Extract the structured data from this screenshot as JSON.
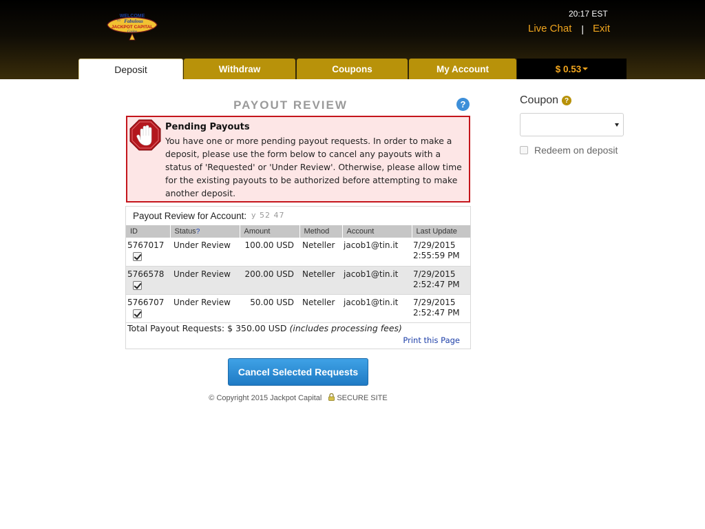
{
  "header": {
    "logo_text": [
      "WELCOME",
      "TO",
      "Fabulous",
      "JACKPOT CAPITAL",
      "Casino"
    ],
    "clock": "20:17 EST",
    "live_chat_label": "Live Chat",
    "separator": "|",
    "exit_label": "Exit"
  },
  "tabs": {
    "deposit": "Deposit",
    "withdraw": "Withdraw",
    "coupons": "Coupons",
    "my_account": "My Account",
    "balance": "$ 0.53"
  },
  "main": {
    "title": "PAYOUT REVIEW",
    "help_icon": "?",
    "alert": {
      "title": "Pending Payouts",
      "text": "You have one or more pending payout requests. In order to make a deposit, please use the form below to cancel any payouts with a status of 'Requested' or 'Under Review'. Otherwise, please allow time for the existing payouts to be authorized before attempting to make another deposit."
    },
    "review": {
      "account_label": "Payout Review for Account:",
      "account_value": "y  52  47",
      "columns": {
        "id": "ID",
        "status": "Status",
        "status_help": "?",
        "amount": "Amount",
        "method": "Method",
        "account": "Account",
        "last_update": "Last Update"
      },
      "rows": [
        {
          "id": "5767017",
          "status": "Under Review",
          "amount": "100.00 USD",
          "method": "Neteller",
          "account": "jacob1@tin.it",
          "date": "7/29/2015",
          "time": "2:55:59 PM",
          "checked": true
        },
        {
          "id": "5766578",
          "status": "Under Review",
          "amount": "200.00 USD",
          "method": "Neteller",
          "account": "jacob1@tin.it",
          "date": "7/29/2015",
          "time": "2:52:47 PM",
          "checked": true
        },
        {
          "id": "5766707",
          "status": "Under Review",
          "amount": "50.00 USD",
          "method": "Neteller",
          "account": "jacob1@tin.it",
          "date": "7/29/2015",
          "time": "2:52:47 PM",
          "checked": true
        }
      ],
      "total_label": "Total Payout Requests:",
      "total_value": "$ 350.00 USD",
      "total_note": "(includes processing fees)",
      "print_link": "Print this Page"
    },
    "cancel_button": "Cancel Selected Requests",
    "footer": {
      "copyright": "© Copyright 2015 Jackpot Capital",
      "secure": "SECURE SITE"
    }
  },
  "sidebar": {
    "coupon_label": "Coupon",
    "coupon_help": "?",
    "coupon_value": "",
    "redeem_label": "Redeem on deposit",
    "redeem_checked": false
  },
  "colors": {
    "gold_tab": "#b8920a",
    "link_orange": "#f0a51e",
    "alert_border": "#c4141b",
    "alert_bg": "#fde6e6",
    "button_blue": "#2a8cd6"
  }
}
